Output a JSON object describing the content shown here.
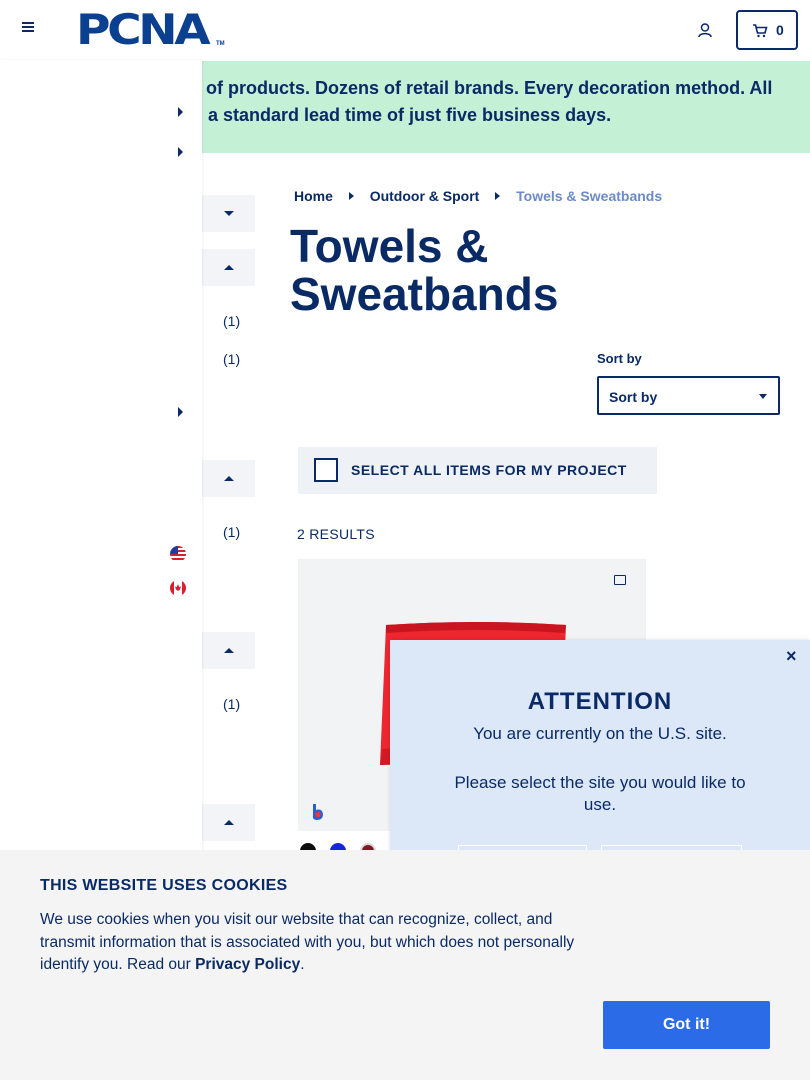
{
  "header": {
    "logo_text": "PCNA",
    "logo_tm": "TM",
    "cart_count": "0",
    "icons": {
      "menu": "hamburger-menu-icon",
      "account": "user-icon",
      "cart": "cart-icon"
    }
  },
  "banner": {
    "line1": "ls of products. Dozens of retail brands. Every decoration method. All",
    "line2": "th a standard lead time of just five business days."
  },
  "filters": {
    "counts": [
      "(1)",
      "(1)",
      "(1)",
      "(1)"
    ]
  },
  "breadcrumb": {
    "items": [
      "Home",
      "Outdoor & Sport",
      "Towels & Sweatbands"
    ]
  },
  "page_title": "Towels & Sweatbands",
  "sort": {
    "label": "Sort by",
    "value": "Sort by"
  },
  "select_all_label": "SELECT ALL ITEMS FOR MY PROJECT",
  "results_label": "2 RESULTS",
  "product": {
    "swatches": [
      "#0d0d0d",
      "#1327d9",
      "#7a1b22"
    ]
  },
  "attention": {
    "close": "×",
    "title": "ATTENTION",
    "message": "You are currently on the U.S. site.",
    "prompt": "Please select the site you would like to use."
  },
  "cookie": {
    "title": "THIS WEBSITE USES COOKIES",
    "text": "We use cookies when you visit our website that can recognize, collect, and transmit information that is associated with you, but which does not personally identify you. Read our ",
    "link": "Privacy Policy",
    "after_link": ".",
    "button": "Got it!"
  },
  "colors": {
    "navy": "#0a2a66",
    "banner_bg": "#c4f0d6",
    "modal_bg": "#dce8f8",
    "accent_button": "#2b6be8",
    "towel": "#ee2630"
  }
}
